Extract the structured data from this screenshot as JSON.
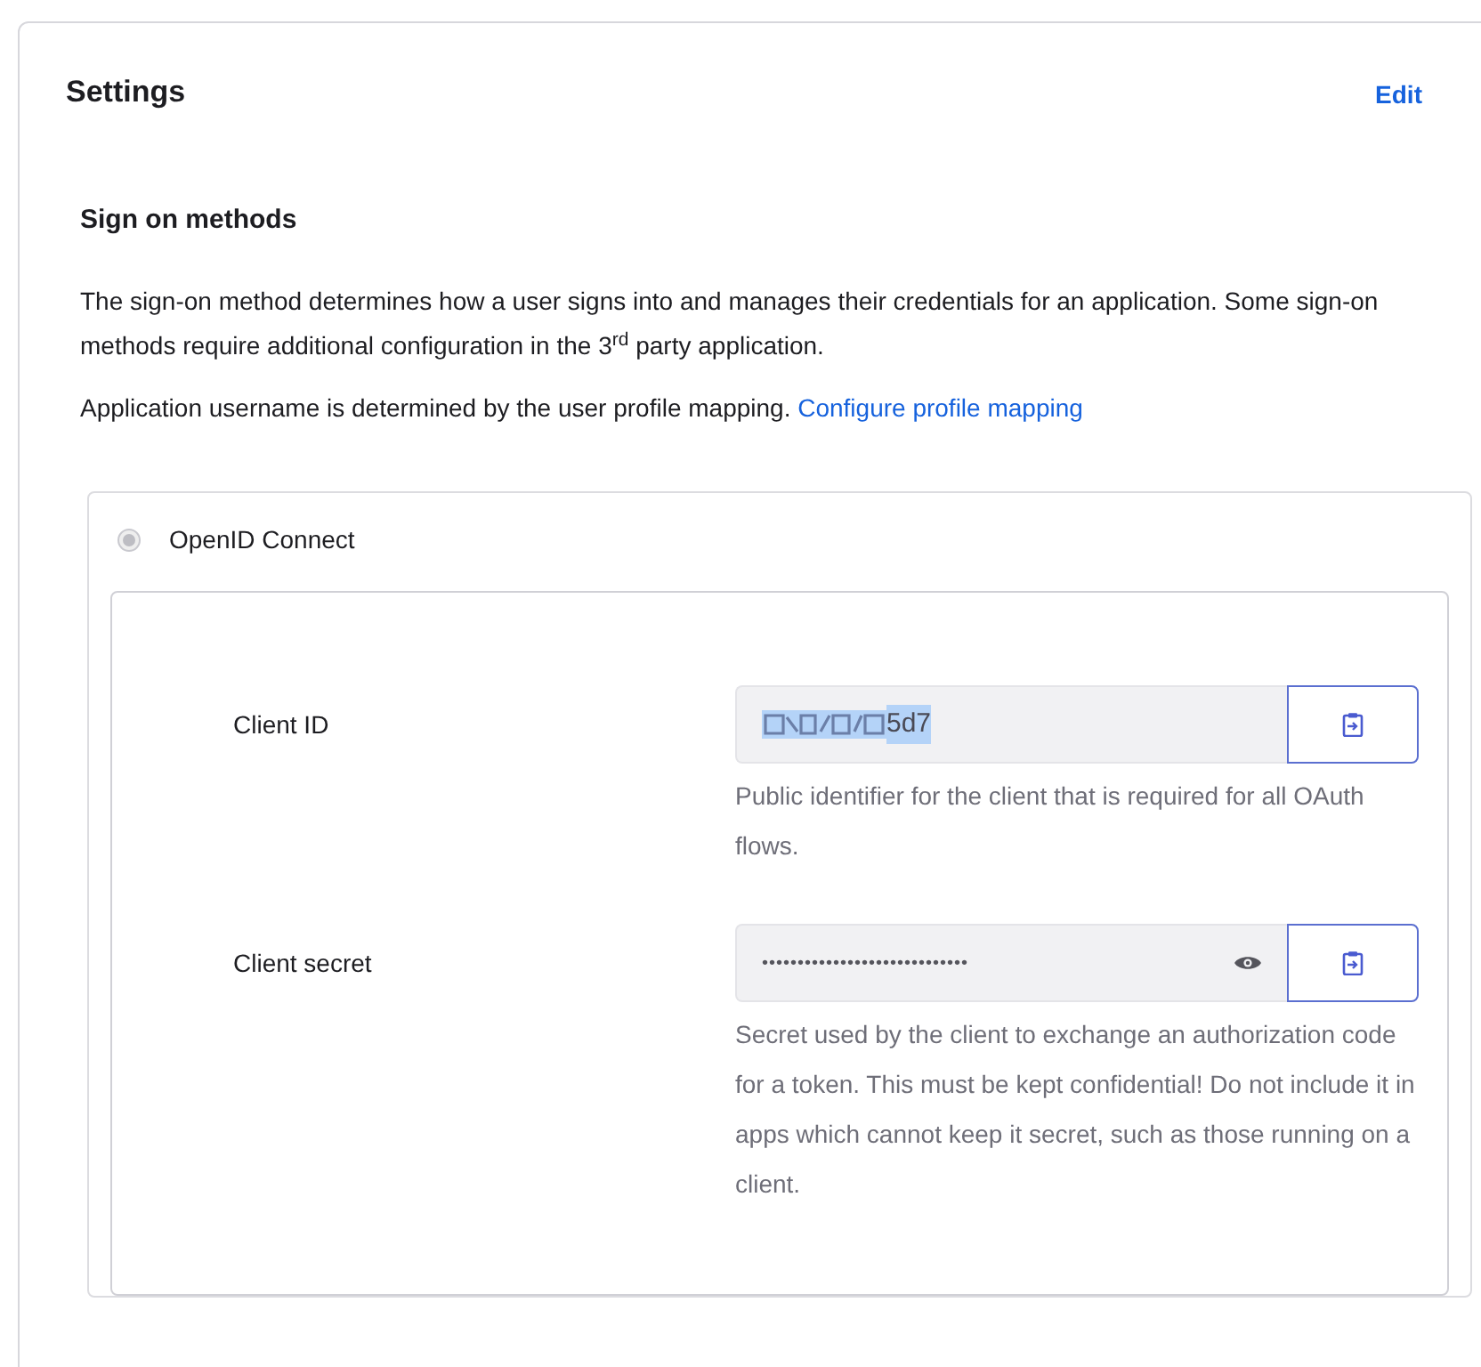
{
  "panel": {
    "title": "Settings",
    "edit_link": "Edit"
  },
  "section": {
    "heading": "Sign on methods",
    "description": "The sign-on method determines how a user signs into and manages their credentials for an application. Some sign-on methods require additional configuration in the 3$^{rd}$ party application.",
    "username_note": "Application username is determined by the user profile mapping.",
    "username_link": "Configure profile mapping"
  },
  "method": {
    "label": "OpenID Connect",
    "checked": true,
    "disabled": true
  },
  "fields": [
    {
      "kind": "text",
      "label": "Client ID",
      "value": "5d7",
      "redacted": true,
      "selected": true,
      "help": "Public identifier for the client that is required for all OAuth flows."
    },
    {
      "kind": "secret",
      "label": "Client secret",
      "value": "•••••••••••••••••••••••••••••",
      "help": "Secret used by the client to exchange an authorization code for a token. This must be kept confidential! Do not include it in apps which cannot keep it secret, such as those running on a client."
    }
  ]
}
